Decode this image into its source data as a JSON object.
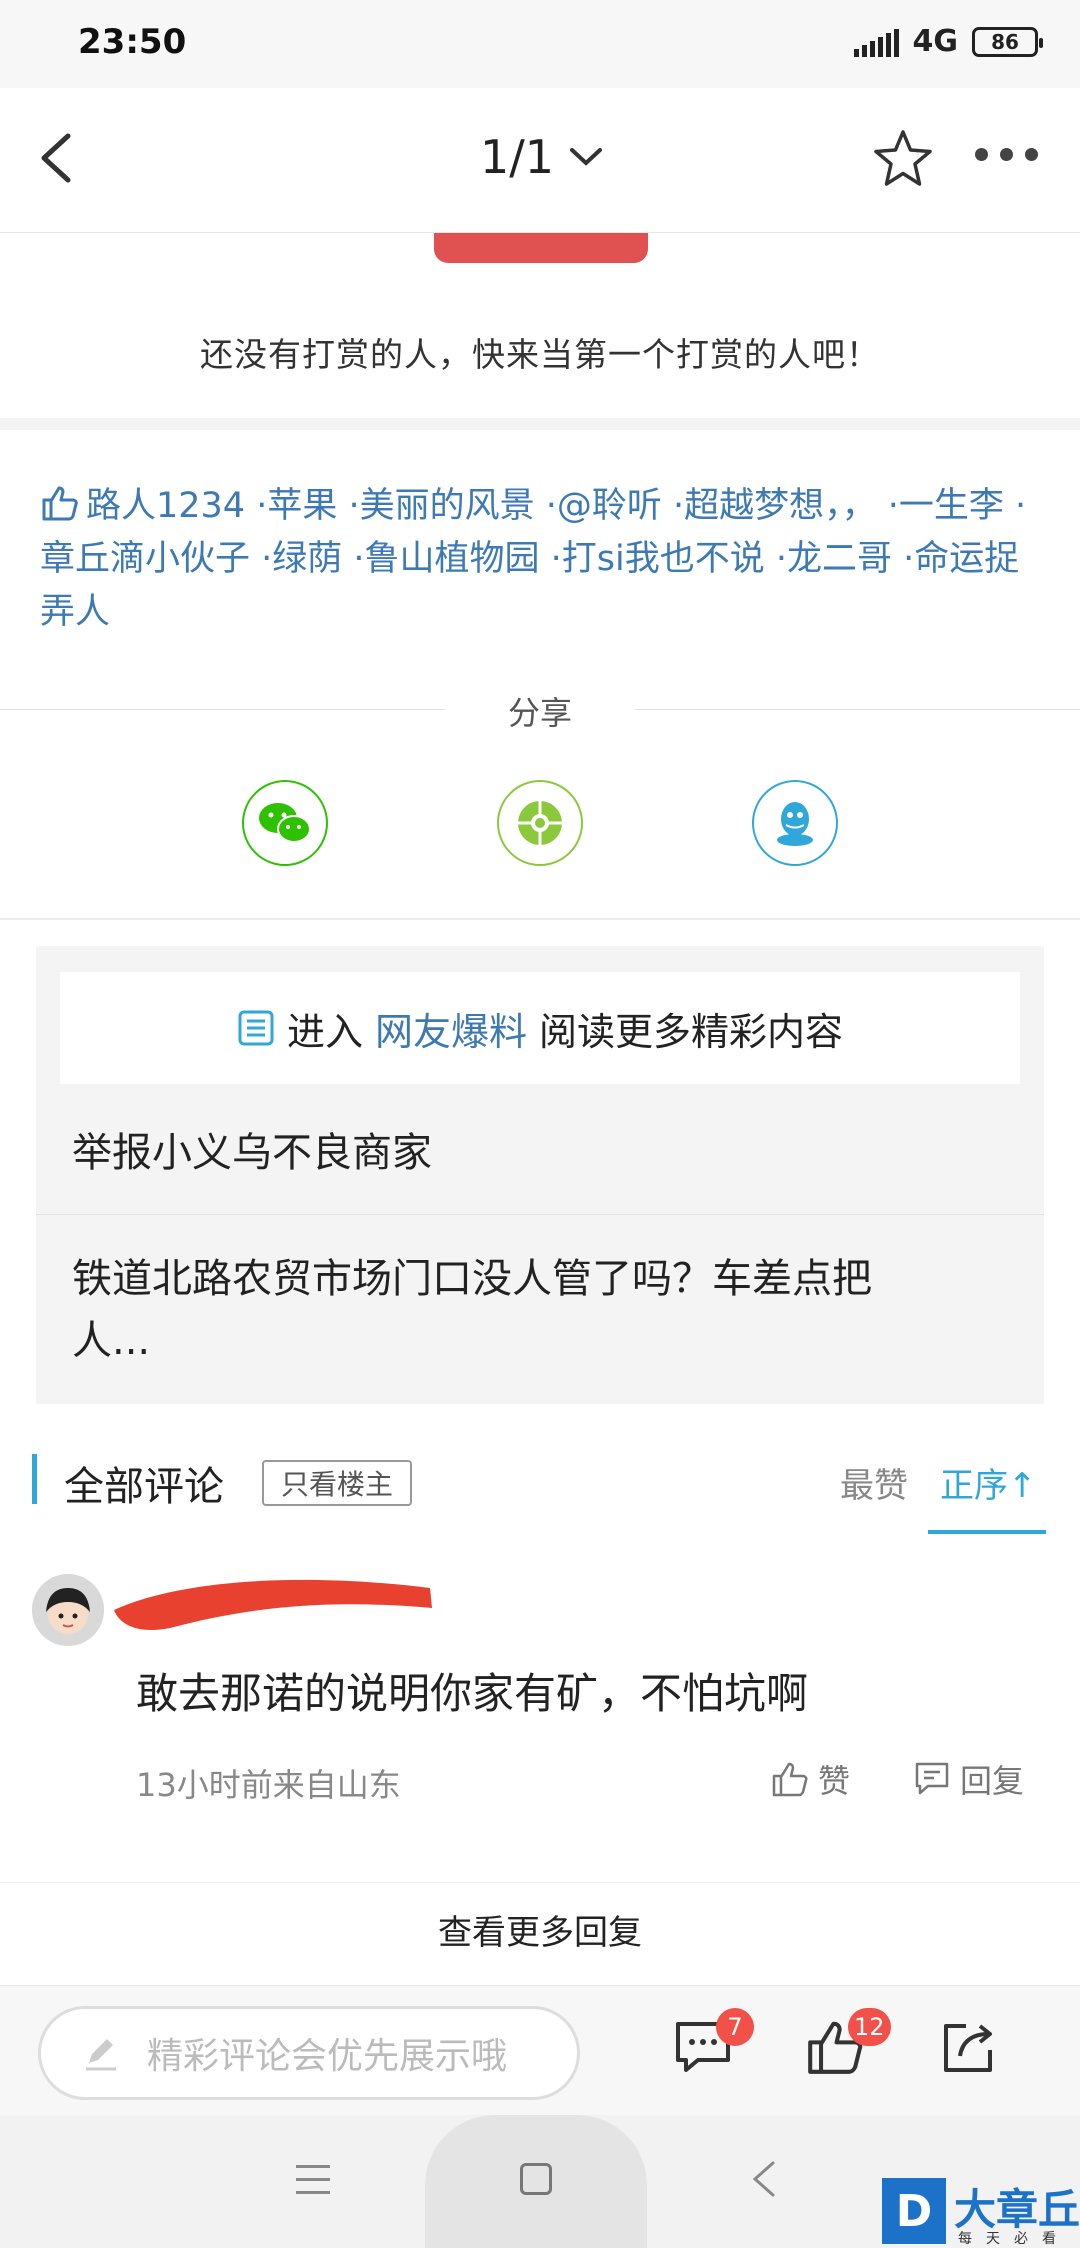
{
  "status_bar": {
    "time": "23:50",
    "network": "4G",
    "battery": "86"
  },
  "nav": {
    "pager": "1/1"
  },
  "reward": {
    "empty_text": "还没有打赏的人，快来当第一个打赏的人吧！"
  },
  "likers": {
    "names": "路人1234 ·苹果 ·美丽的风景 ·@聆听 ·超越梦想，， ·一生李 ·章丘滴小伙子 ·绿荫 ·鲁山植物园 ·打si我也不说 ·龙二哥 ·命运捉弄人"
  },
  "share": {
    "title": "分享",
    "targets": [
      {
        "icon": "wechat-icon",
        "color": "#2dc100"
      },
      {
        "icon": "moments-icon",
        "color": "#8cc83c"
      },
      {
        "icon": "qq-icon",
        "color": "#2fa7d8"
      }
    ]
  },
  "hot": {
    "banner_prefix": "进入",
    "banner_link": "网友爆料",
    "banner_suffix": "阅读更多精彩内容",
    "items": [
      {
        "title": "举报小义乌不良商家"
      },
      {
        "title_line1": "铁道北路农贸市场门口没人管了吗？车差点把",
        "title_line2": "人..."
      }
    ]
  },
  "comments": {
    "title": "全部评论",
    "only_host": "只看楼主",
    "sort_hot": "最赞",
    "sort_asc": "正序↑",
    "items": [
      {
        "text": "敢去那诺的说明你家有矿，不怕坑啊",
        "meta": "13小时前来自山东",
        "like_label": "赞",
        "reply_label": "回复"
      }
    ],
    "more_replies": "查看更多回复"
  },
  "bottom_bar": {
    "placeholder": "精彩评论会优先展示哦",
    "comment_count": "7",
    "like_count": "12"
  },
  "watermark": {
    "name": "大章丘",
    "logo_letter": "D",
    "slogan": "每天必看"
  },
  "colors": {
    "accent": "#2fa7d8",
    "link": "#3d7ab3",
    "badge": "#f2514a",
    "reward": "#e05252"
  }
}
